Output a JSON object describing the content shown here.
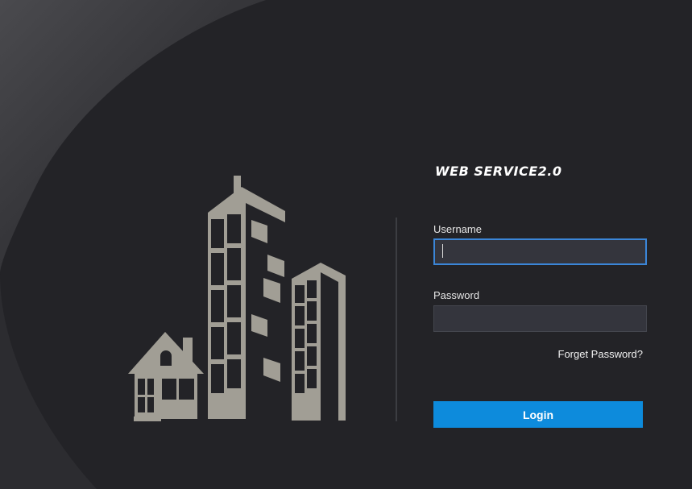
{
  "app": {
    "title": "WEB SERVICE2.0"
  },
  "form": {
    "username_label": "Username",
    "username_value": "",
    "password_label": "Password",
    "password_value": "",
    "forget_link": "Forget Password?",
    "login_label": "Login"
  },
  "colors": {
    "background": "#232327",
    "accent": "#0d8bdc",
    "focus_border": "#3b86d8",
    "input_bg": "#34353d",
    "illustration": "#a19e95"
  },
  "icons": {
    "illustration": "buildings-illustration"
  }
}
